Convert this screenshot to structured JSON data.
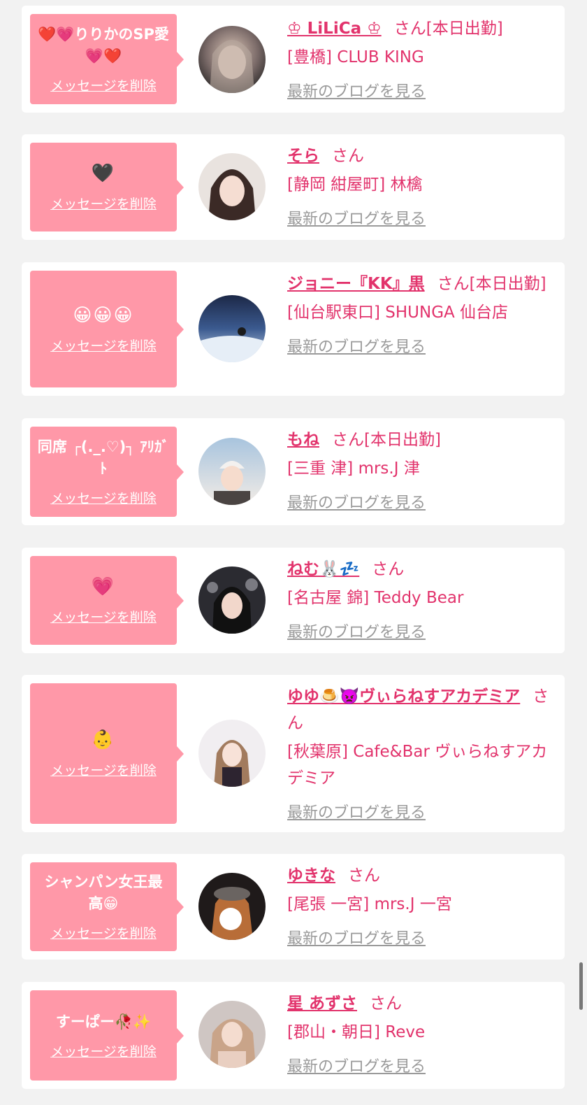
{
  "actions": {
    "delete_label": "メッセージを削除",
    "blog_label": "最新のブログを見る",
    "honorific": "さん"
  },
  "items": [
    {
      "message": "❤️💗りりかのSP愛💗❤️",
      "name": "♔ LiLiCa ♔",
      "status": "[本日出勤]",
      "shop": "[豊橋] CLUB KING"
    },
    {
      "message": "🖤",
      "name": "そら",
      "status": "",
      "shop": "[静岡 紺屋町] 林檎"
    },
    {
      "message": "😀😀😀",
      "name": "ジョニー『KK』黒",
      "status": "[本日出勤]",
      "shop": "[仙台駅東口] SHUNGA 仙台店"
    },
    {
      "message": "同席 ┌(._.♡)┐ ｱﾘｶﾞﾄ",
      "name": "もね",
      "status": "[本日出勤]",
      "shop": "[三重 津] mrs.J 津"
    },
    {
      "message": "💗",
      "name": "ねむ🐰💤",
      "status": "",
      "shop": "[名古屋 錦] Teddy Bear"
    },
    {
      "message": "👶",
      "name": "ゆゆ🍮👿ヴぃらねすアカデミア",
      "status": "",
      "shop": "[秋葉原] Cafe&Bar ヴぃらねすアカデミア"
    },
    {
      "message": "シャンパン女王最高😁",
      "name": "ゆきな",
      "status": "",
      "shop": "[尾張 一宮] mrs.J 一宮"
    },
    {
      "message": "すーぱー🥀✨",
      "name": "星 あずさ",
      "status": "",
      "shop": "[郡山・朝日] Reve"
    }
  ],
  "colors": {
    "accent": "#e2336c",
    "message_bg": "#ff98a8",
    "link_gray": "#9a9a9a"
  }
}
